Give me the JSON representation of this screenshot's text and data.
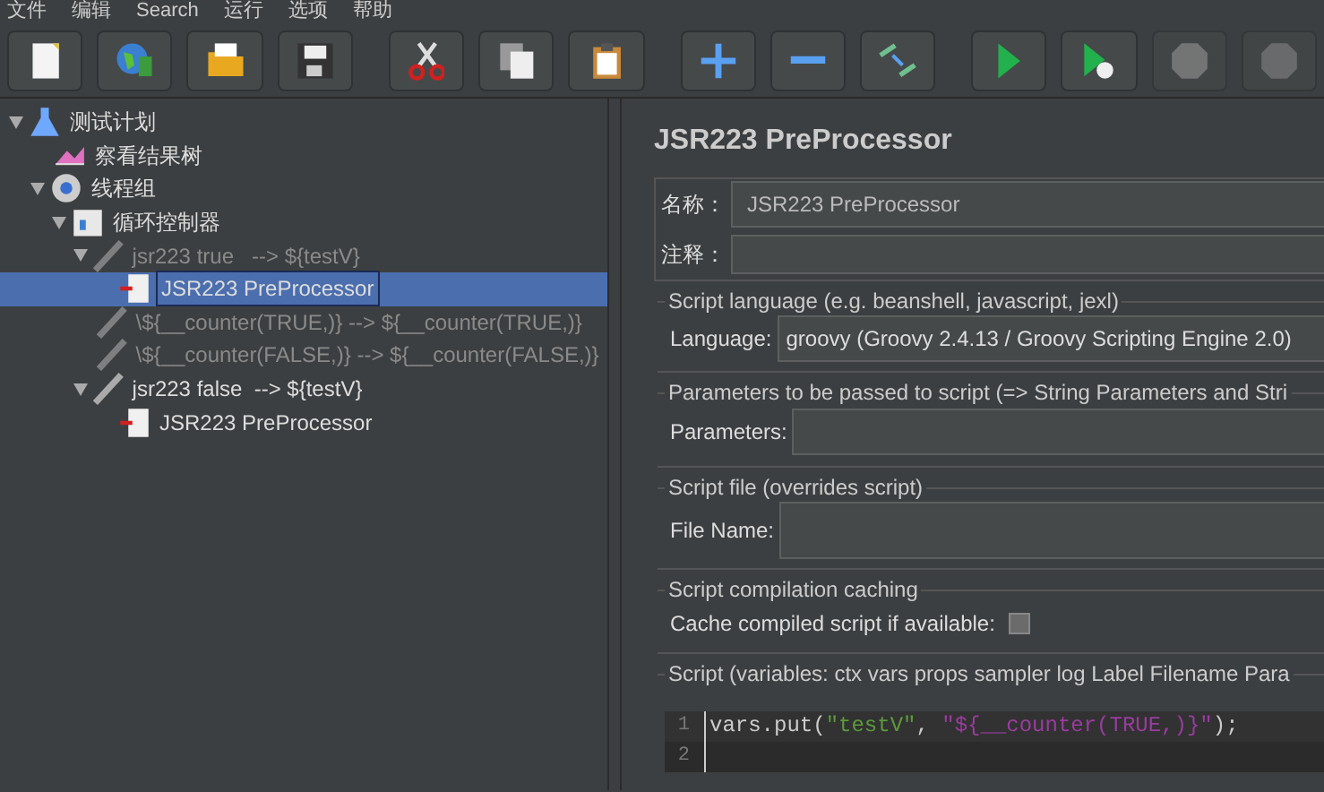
{
  "menu": [
    "文件",
    "编辑",
    "Search",
    "运行",
    "选项",
    "帮助"
  ],
  "toolbar": [
    {
      "kind": "new",
      "enabled": true
    },
    {
      "kind": "templates",
      "enabled": true
    },
    {
      "kind": "open",
      "enabled": true
    },
    {
      "kind": "save",
      "enabled": true
    },
    {
      "kind": "cut",
      "enabled": true
    },
    {
      "kind": "copy",
      "enabled": true
    },
    {
      "kind": "paste",
      "enabled": true
    },
    {
      "kind": "expand",
      "enabled": true
    },
    {
      "kind": "collapse",
      "enabled": true
    },
    {
      "kind": "toggle",
      "enabled": true
    },
    {
      "kind": "start",
      "enabled": true
    },
    {
      "kind": "start-no-pause",
      "enabled": true
    },
    {
      "kind": "stop",
      "enabled": false
    },
    {
      "kind": "shutdown",
      "enabled": false
    }
  ],
  "tree": [
    {
      "label": "测试计划",
      "kind": "plan",
      "expanded": true,
      "selected": false,
      "disabled": false,
      "children": [
        {
          "label": "察看结果树",
          "kind": "listener",
          "selected": false,
          "disabled": false
        },
        {
          "label": "线程组",
          "kind": "threadgroup",
          "expanded": true,
          "selected": false,
          "disabled": false,
          "children": [
            {
              "label": "循环控制器",
              "kind": "loop",
              "expanded": true,
              "selected": false,
              "disabled": false,
              "children": [
                {
                  "label": "jsr223 true   --> ${testV}",
                  "kind": "sampler",
                  "expanded": true,
                  "selected": false,
                  "disabled": true,
                  "children": [
                    {
                      "label": "JSR223 PreProcessor",
                      "kind": "preprocessor",
                      "selected": true,
                      "disabled": false
                    }
                  ]
                },
                {
                  "label": "\\${__counter(TRUE,)} --> ${__counter(TRUE,)}",
                  "kind": "sampler",
                  "selected": false,
                  "disabled": true
                },
                {
                  "label": "\\${__counter(FALSE,)} --> ${__counter(FALSE,)}",
                  "kind": "sampler",
                  "selected": false,
                  "disabled": true
                },
                {
                  "label": "jsr223 false  --> ${testV}",
                  "kind": "sampler",
                  "expanded": true,
                  "selected": false,
                  "disabled": false,
                  "children": [
                    {
                      "label": "JSR223 PreProcessor",
                      "kind": "preprocessor",
                      "selected": false,
                      "disabled": false
                    }
                  ]
                }
              ]
            }
          ]
        }
      ]
    }
  ],
  "panel": {
    "title": "JSR223 PreProcessor",
    "name": {
      "label": "名称：",
      "value": "JSR223 PreProcessor"
    },
    "comment": {
      "label": "注释："
    },
    "language_group": {
      "legend": "Script language (e.g. beanshell, javascript, jexl)",
      "label": "Language:",
      "value": "groovy     (Groovy 2.4.13 / Groovy Scripting Engine 2.0)"
    },
    "parameters_group": {
      "legend": "Parameters to be passed to script (=> String Parameters and Stri",
      "label": "Parameters:"
    },
    "file_group": {
      "legend": "Script file (overrides script)",
      "label": "File Name:"
    },
    "cache_group": {
      "legend": "Script compilation caching",
      "label": "Cache compiled script if available:",
      "checked": false
    },
    "script_group": {
      "legend": "Script (variables: ctx vars props sampler log Label Filename Para",
      "lines": [
        {
          "number": "1",
          "tokens": [
            {
              "text": "vars.put(",
              "kind": "plain"
            },
            {
              "text": "\"testV\"",
              "kind": "string"
            },
            {
              "text": ", ",
              "kind": "plain"
            },
            {
              "text": "\"${__counter(TRUE,)}\"",
              "kind": "gstring"
            },
            {
              "text": ");",
              "kind": "plain"
            }
          ]
        },
        {
          "number": "2"
        }
      ]
    }
  }
}
